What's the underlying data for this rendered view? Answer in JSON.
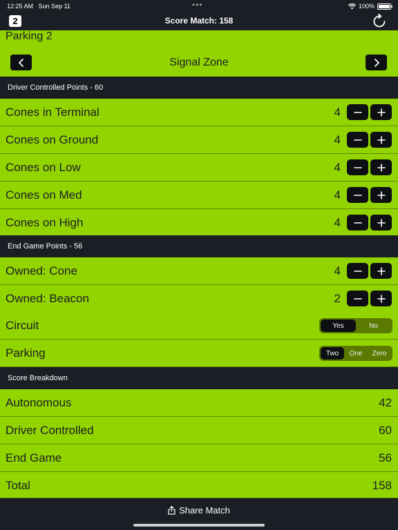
{
  "status": {
    "time": "12:25 AM",
    "date": "Sun Sep 11",
    "battery": "100%"
  },
  "nav": {
    "badge": "2",
    "title": "Score Match: 158"
  },
  "parking_title": "Parking 2",
  "zone": {
    "title": "Signal Zone"
  },
  "sections": {
    "driver": "Driver Controlled Points - 60",
    "endgame": "End Game Points - 56",
    "breakdown": "Score Breakdown"
  },
  "driver_rows": [
    {
      "label": "Cones in Terminal",
      "value": "4"
    },
    {
      "label": "Cones on Ground",
      "value": "4"
    },
    {
      "label": "Cones on Low",
      "value": "4"
    },
    {
      "label": "Cones on Med",
      "value": "4"
    },
    {
      "label": "Cones on High",
      "value": "4"
    }
  ],
  "endgame_rows": [
    {
      "label": "Owned: Cone",
      "value": "4"
    },
    {
      "label": "Owned: Beacon",
      "value": "2"
    }
  ],
  "circuit": {
    "label": "Circuit",
    "options": [
      "Yes",
      "No"
    ],
    "selected": "Yes"
  },
  "parking": {
    "label": "Parking",
    "options": [
      "Two",
      "One",
      "Zero"
    ],
    "selected": "Two"
  },
  "breakdown_rows": [
    {
      "label": "Autonomous",
      "value": "42"
    },
    {
      "label": "Driver Controlled",
      "value": "60"
    },
    {
      "label": "End Game",
      "value": "56"
    },
    {
      "label": "Total",
      "value": "158"
    }
  ],
  "footer": {
    "share_label": "Share Match"
  },
  "colors": {
    "accent_green": "#92d400",
    "dark_bg": "#1b1e24",
    "button_black": "#0d0f12"
  }
}
